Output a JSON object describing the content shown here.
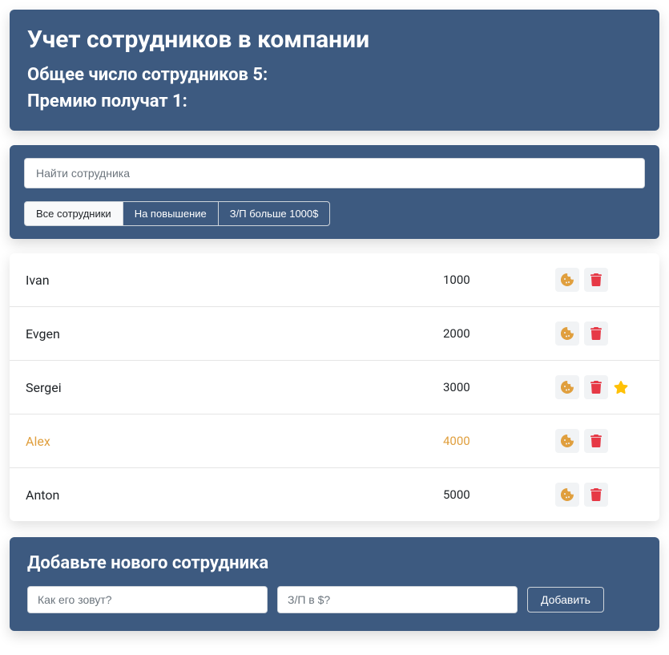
{
  "header": {
    "title": "Учет сотрудников в компании",
    "total_label": "Общее число сотрудников 5:",
    "bonus_label": "Премию получат 1:"
  },
  "search": {
    "placeholder": "Найти сотрудника"
  },
  "filters": [
    {
      "label": "Все сотрудники",
      "active": true
    },
    {
      "label": "На повышение",
      "active": false
    },
    {
      "label": "З/П больше 1000$",
      "active": false
    }
  ],
  "employees": [
    {
      "name": "Ivan",
      "salary": "1000",
      "increase": false,
      "star": false
    },
    {
      "name": "Evgen",
      "salary": "2000",
      "increase": false,
      "star": false
    },
    {
      "name": "Sergei",
      "salary": "3000",
      "increase": false,
      "star": true
    },
    {
      "name": "Alex",
      "salary": "4000",
      "increase": true,
      "star": false
    },
    {
      "name": "Anton",
      "salary": "5000",
      "increase": false,
      "star": false
    }
  ],
  "add": {
    "title": "Добавьте нового сотрудника",
    "name_placeholder": "Как его зовут?",
    "salary_placeholder": "З/П в $?",
    "button": "Добавить"
  },
  "colors": {
    "panel": "#3d5a80",
    "increase": "#e09f3e",
    "trash": "#e63946",
    "cookie": "#e09f3e",
    "star": "#ffc107"
  }
}
